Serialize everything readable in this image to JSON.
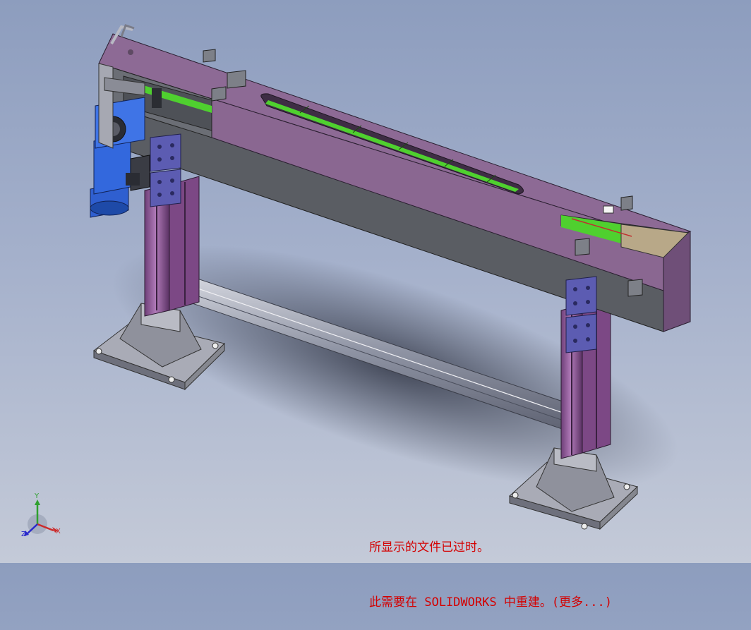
{
  "viewport": {
    "background_top": "#8d9dbe",
    "background_bottom": "#c4cad8"
  },
  "model_colors": {
    "housing_top": "#8c6a93",
    "housing_side": "#585b60",
    "housing_dark": "#4a4d52",
    "belt": "#4fd02f",
    "motor": "#2f5fd0",
    "column": "#9a5fa0",
    "bracket": "#5a5ab0",
    "base": "#9a9ca8",
    "rail": "#b9bcc8"
  },
  "triad": {
    "x_label": "X",
    "y_label": "Y",
    "z_label": "Z",
    "x_color": "#cc2a2a",
    "y_color": "#2fa02f",
    "z_color": "#2a2acc"
  },
  "notice": {
    "line1": "所显示的文件已过时。",
    "line2": "此需要在 SOLIDWORKS 中重建。(更多...)",
    "color": "#d40000"
  }
}
